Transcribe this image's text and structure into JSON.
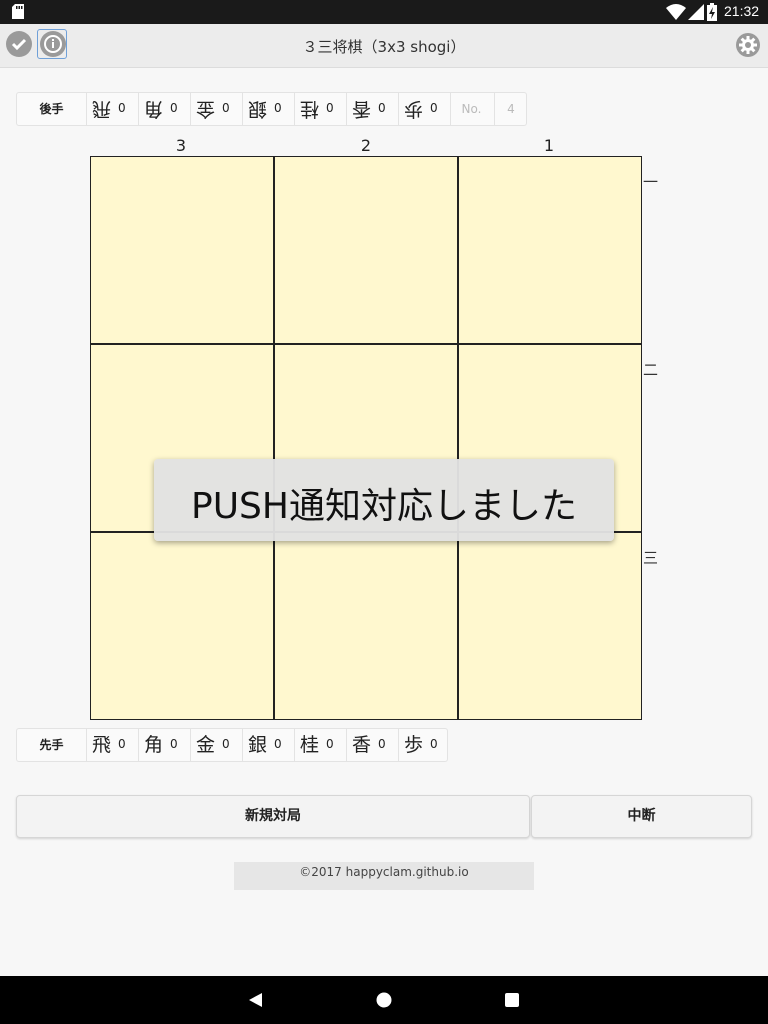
{
  "status_bar": {
    "time": "21:32"
  },
  "app_bar": {
    "title": "３三将棋（3x3 shogi）"
  },
  "gote_hand": {
    "label": "後手",
    "pieces": [
      {
        "char": "飛",
        "count": "0"
      },
      {
        "char": "角",
        "count": "0"
      },
      {
        "char": "金",
        "count": "0"
      },
      {
        "char": "銀",
        "count": "0"
      },
      {
        "char": "桂",
        "count": "0"
      },
      {
        "char": "香",
        "count": "0"
      },
      {
        "char": "歩",
        "count": "0"
      }
    ],
    "move_label": "No.",
    "move_number": "4"
  },
  "sente_hand": {
    "label": "先手",
    "pieces": [
      {
        "char": "飛",
        "count": "0"
      },
      {
        "char": "角",
        "count": "0"
      },
      {
        "char": "金",
        "count": "0"
      },
      {
        "char": "銀",
        "count": "0"
      },
      {
        "char": "桂",
        "count": "0"
      },
      {
        "char": "香",
        "count": "0"
      },
      {
        "char": "歩",
        "count": "0"
      }
    ]
  },
  "board": {
    "files": [
      "3",
      "2",
      "1"
    ],
    "ranks": [
      "一",
      "二",
      "三"
    ],
    "cell_color": "#fff8cf"
  },
  "toast": {
    "message": "PUSH通知対応しました"
  },
  "buttons": {
    "new_game": "新規対局",
    "pause": "中断"
  },
  "footer": {
    "text": "©2017 happyclam.github.io"
  }
}
